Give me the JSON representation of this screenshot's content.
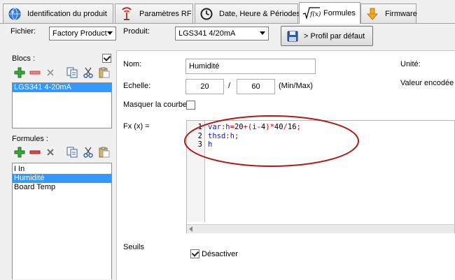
{
  "tabs": [
    {
      "label": "Identification du produit",
      "icon": "globe-icon"
    },
    {
      "label": "Paramètres RF",
      "icon": "antenna-icon"
    },
    {
      "label": "Date, Heure & Périodes",
      "icon": "clock-icon"
    },
    {
      "label": "Formules",
      "icon": "function-icon",
      "active": true
    },
    {
      "label": "Firmware",
      "icon": "download-arrow-icon"
    }
  ],
  "toolbar": {
    "fichier_label": "Fichier:",
    "fichier_value": "Factory Product",
    "produit_label": "Produit:",
    "produit_value": "LGS341 4/20mA",
    "profil_button": "> Profil par défaut"
  },
  "blocs": {
    "label": "Blocs :",
    "checked": true,
    "items": [
      "LGS341 4-20mA"
    ],
    "selected_index": 0
  },
  "formules": {
    "label": "Formules :",
    "items": [
      "I In",
      "Humidité",
      "Board Temp"
    ],
    "selected_index": 1
  },
  "details": {
    "nom_label": "Nom:",
    "nom_value": "Humidité",
    "unite_label": "Unité:",
    "echelle_label": "Echelle:",
    "echelle_min": "20",
    "echelle_sep": "/",
    "echelle_max": "60",
    "echelle_unit": "(Min/Max)",
    "valeur_label": "Valeur encodée",
    "masquer_label": "Masquer la courbe",
    "masquer_checked": false,
    "fx_label": "Fx (x) =",
    "code_lines": [
      {
        "num": "1",
        "tokens": [
          [
            "kw",
            "var"
          ],
          [
            "op",
            ":"
          ],
          [
            "kw",
            "h"
          ],
          [
            "op",
            "="
          ],
          [
            "num",
            "20"
          ],
          [
            "op",
            "+"
          ],
          [
            "op",
            "("
          ],
          [
            "kw",
            "i"
          ],
          [
            "op",
            "-"
          ],
          [
            "num",
            "4"
          ],
          [
            "op",
            ")"
          ],
          [
            "op",
            "*"
          ],
          [
            "num",
            "40"
          ],
          [
            "op",
            "/"
          ],
          [
            "num",
            "16"
          ],
          [
            "op",
            ";"
          ]
        ]
      },
      {
        "num": "2",
        "tokens": [
          [
            "kw",
            "thsd"
          ],
          [
            "op",
            ":"
          ],
          [
            "kw",
            "h"
          ],
          [
            "op",
            ";"
          ]
        ]
      },
      {
        "num": "3",
        "tokens": [
          [
            "kw",
            "h"
          ]
        ]
      }
    ],
    "seuils_label": "Seuils",
    "desactiver_label": "Désactiver",
    "desactiver_checked": true
  },
  "colors": {
    "selection": "#3399ff",
    "annotation_ellipse": "#b01818",
    "keyword": "#1a1aa6",
    "operator": "#c00000"
  }
}
